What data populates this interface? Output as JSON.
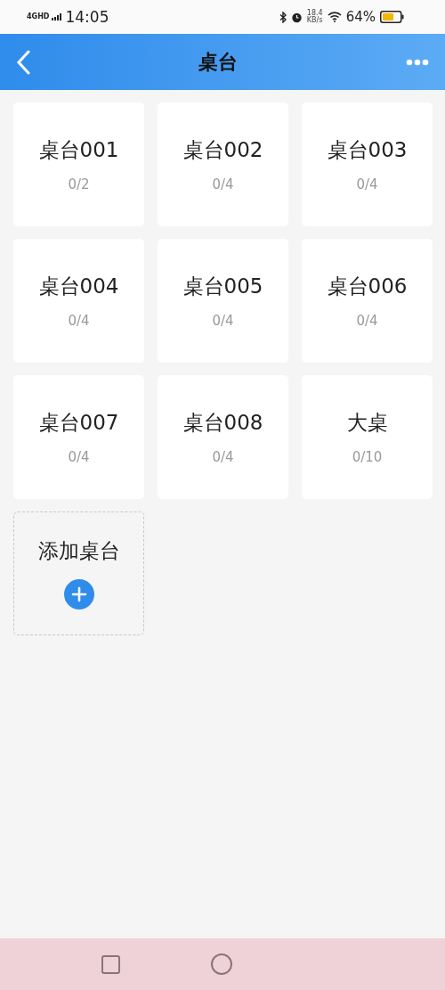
{
  "status_bar": {
    "network": "4GHD",
    "time": "14:05",
    "speed_value": "18.4",
    "speed_unit": "KB/s",
    "battery": "64%"
  },
  "header": {
    "title": "桌台"
  },
  "tables": [
    {
      "name": "桌台001",
      "seats": "0/2"
    },
    {
      "name": "桌台002",
      "seats": "0/4"
    },
    {
      "name": "桌台003",
      "seats": "0/4"
    },
    {
      "name": "桌台004",
      "seats": "0/4"
    },
    {
      "name": "桌台005",
      "seats": "0/4"
    },
    {
      "name": "桌台006",
      "seats": "0/4"
    },
    {
      "name": "桌台007",
      "seats": "0/4"
    },
    {
      "name": "桌台008",
      "seats": "0/4"
    },
    {
      "name": "大桌",
      "seats": "0/10"
    }
  ],
  "add_table": {
    "label": "添加桌台"
  }
}
